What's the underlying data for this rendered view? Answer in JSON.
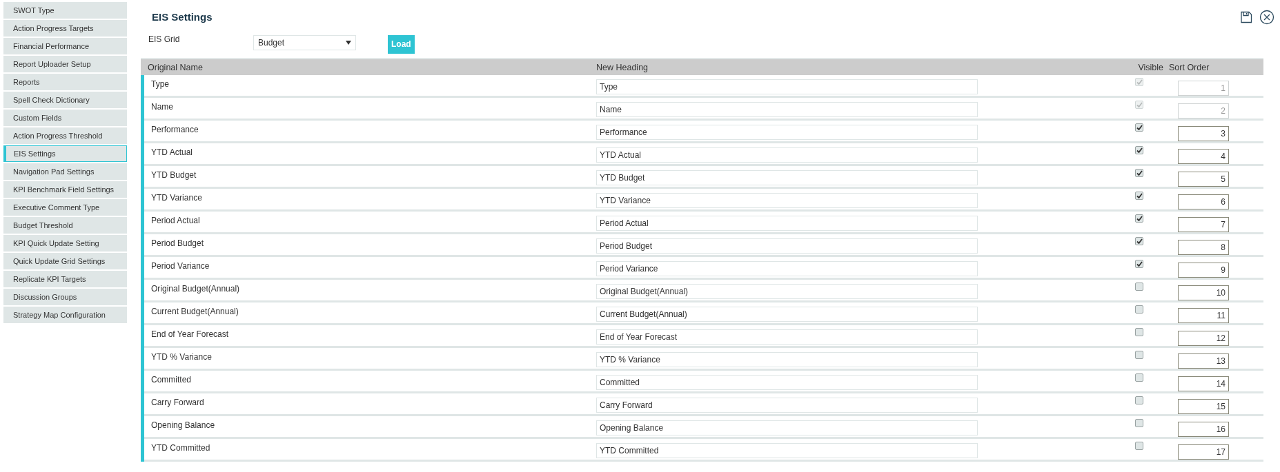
{
  "sidebar": {
    "items": [
      {
        "label": "SWOT Type",
        "selected": false
      },
      {
        "label": "Action Progress Targets",
        "selected": false
      },
      {
        "label": "Financial Performance",
        "selected": false
      },
      {
        "label": "Report Uploader Setup",
        "selected": false
      },
      {
        "label": "Reports",
        "selected": false
      },
      {
        "label": "Spell Check Dictionary",
        "selected": false
      },
      {
        "label": "Custom Fields",
        "selected": false
      },
      {
        "label": "Action Progress Threshold",
        "selected": false
      },
      {
        "label": "EIS Settings",
        "selected": true
      },
      {
        "label": "Navigation Pad Settings",
        "selected": false
      },
      {
        "label": "KPI Benchmark Field Settings",
        "selected": false
      },
      {
        "label": "Executive Comment Type",
        "selected": false
      },
      {
        "label": "Budget Threshold",
        "selected": false
      },
      {
        "label": "KPI Quick Update Setting",
        "selected": false
      },
      {
        "label": "Quick Update Grid Settings",
        "selected": false
      },
      {
        "label": "Replicate KPI Targets",
        "selected": false
      },
      {
        "label": "Discussion Groups",
        "selected": false
      },
      {
        "label": "Strategy Map Configuration",
        "selected": false
      }
    ]
  },
  "page": {
    "title": "EIS Settings",
    "grid_label": "EIS Grid",
    "grid_value": "Budget",
    "load_button": "Load"
  },
  "table": {
    "columns": [
      "Original Name",
      "New Heading",
      "Visible",
      "Sort Order"
    ],
    "rows": [
      {
        "original": "Type",
        "heading": "Type",
        "visible": true,
        "disabled": true,
        "sort": "1"
      },
      {
        "original": "Name",
        "heading": "Name",
        "visible": true,
        "disabled": true,
        "sort": "2"
      },
      {
        "original": "Performance",
        "heading": "Performance",
        "visible": true,
        "disabled": false,
        "sort": "3"
      },
      {
        "original": "YTD Actual",
        "heading": "YTD Actual",
        "visible": true,
        "disabled": false,
        "sort": "4"
      },
      {
        "original": "YTD Budget",
        "heading": "YTD Budget",
        "visible": true,
        "disabled": false,
        "sort": "5"
      },
      {
        "original": "YTD Variance",
        "heading": "YTD Variance",
        "visible": true,
        "disabled": false,
        "sort": "6"
      },
      {
        "original": "Period Actual",
        "heading": "Period Actual",
        "visible": true,
        "disabled": false,
        "sort": "7"
      },
      {
        "original": "Period Budget",
        "heading": "Period Budget",
        "visible": true,
        "disabled": false,
        "sort": "8"
      },
      {
        "original": "Period Variance",
        "heading": "Period Variance",
        "visible": true,
        "disabled": false,
        "sort": "9"
      },
      {
        "original": "Original Budget(Annual)",
        "heading": "Original Budget(Annual)",
        "visible": false,
        "disabled": false,
        "sort": "10"
      },
      {
        "original": "Current Budget(Annual)",
        "heading": "Current Budget(Annual)",
        "visible": false,
        "disabled": false,
        "sort": "11"
      },
      {
        "original": "End of Year Forecast",
        "heading": "End of Year Forecast",
        "visible": false,
        "disabled": false,
        "sort": "12"
      },
      {
        "original": "YTD % Variance",
        "heading": "YTD % Variance",
        "visible": false,
        "disabled": false,
        "sort": "13"
      },
      {
        "original": "Committed",
        "heading": "Committed",
        "visible": false,
        "disabled": false,
        "sort": "14"
      },
      {
        "original": "Carry Forward",
        "heading": "Carry Forward",
        "visible": false,
        "disabled": false,
        "sort": "15"
      },
      {
        "original": "Opening Balance",
        "heading": "Opening Balance",
        "visible": false,
        "disabled": false,
        "sort": "16"
      },
      {
        "original": "YTD Committed",
        "heading": "YTD Committed",
        "visible": false,
        "disabled": false,
        "sort": "17"
      }
    ]
  }
}
